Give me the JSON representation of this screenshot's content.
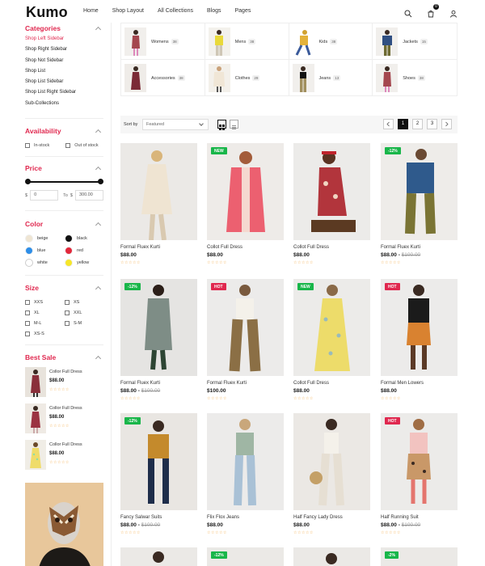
{
  "brand": "Kumo",
  "nav": [
    "Home",
    "Shop Layout",
    "All Collections",
    "Blogs",
    "Pages"
  ],
  "cart_count": "0",
  "sidebar": {
    "categories_title": "Categories",
    "categories": [
      "Shop Left Sidebar",
      "Shop Right Sidebar",
      "Shop Not Sidebar",
      "Shop List",
      "Shop List Sidebar",
      "Shop List Right Sidebar",
      "Sub-Collections"
    ],
    "availability_title": "Availability",
    "in_stock": "In-stock",
    "out_of_stock": "Out of stock",
    "price_title": "Price",
    "currency": "$",
    "price_min": "0",
    "price_to": "To",
    "price_max": "300.00",
    "color_title": "Color",
    "colors": [
      {
        "name": "beige",
        "hex": "#efe5d3"
      },
      {
        "name": "black",
        "hex": "#111111"
      },
      {
        "name": "blue",
        "hex": "#2d8ee8"
      },
      {
        "name": "red",
        "hex": "#e2283b"
      },
      {
        "name": "white",
        "hex": "#ffffff"
      },
      {
        "name": "yellow",
        "hex": "#f6e62a"
      }
    ],
    "size_title": "Size",
    "sizes": [
      "XXS",
      "XS",
      "XL",
      "XXL",
      "M-L",
      "S-M",
      "XS-S"
    ],
    "best_sale_title": "Best Sale",
    "best_sale": [
      {
        "name": "Collor Full Dress",
        "price": "$88.00"
      },
      {
        "name": "Collor Full Dress",
        "price": "$88.00"
      },
      {
        "name": "Collor Full Dress",
        "price": "$88.00"
      }
    ]
  },
  "subcollections": [
    {
      "label": "Womens",
      "count": "38"
    },
    {
      "label": "Mens",
      "count": "38"
    },
    {
      "label": "Kids",
      "count": "38"
    },
    {
      "label": "Jackets",
      "count": "15"
    },
    {
      "label": "Accessories",
      "count": "38"
    },
    {
      "label": "Clothes",
      "count": "29"
    },
    {
      "label": "Jeans",
      "count": "13"
    },
    {
      "label": "Shoes",
      "count": "38"
    }
  ],
  "toolbar": {
    "sort_label": "Sort by",
    "sort_value": "Featured",
    "pages": [
      "1",
      "2",
      "3"
    ]
  },
  "stars": "☆☆☆☆☆",
  "products": [
    {
      "name": "Formal Fluex Kurti",
      "price": "$88.00",
      "old": "",
      "badge": "",
      "badge_type": ""
    },
    {
      "name": "Collot Full Dress",
      "price": "$88.00",
      "old": "",
      "badge": "NEW",
      "badge_type": "new"
    },
    {
      "name": "Collot Full Dress",
      "price": "$88.00",
      "old": "",
      "badge": "",
      "badge_type": ""
    },
    {
      "name": "Formal Fluex Kurti",
      "price": "$88.00",
      "old": "$100.00",
      "badge": "-12%",
      "badge_type": "sale"
    },
    {
      "name": "Formal Fluex Kurti",
      "price": "$88.00",
      "old": "$100.00",
      "badge": "-12%",
      "badge_type": "sale"
    },
    {
      "name": "Formal Fluex Kurti",
      "price": "$100.00",
      "old": "",
      "badge": "HOT",
      "badge_type": "hot"
    },
    {
      "name": "Collot Full Dress",
      "price": "$88.00",
      "old": "",
      "badge": "NEW",
      "badge_type": "new"
    },
    {
      "name": "Formal Men Lowers",
      "price": "$88.00",
      "old": "",
      "badge": "HOT",
      "badge_type": "hot"
    },
    {
      "name": "Fancy Salwar Suits",
      "price": "$88.00",
      "old": "$100.00",
      "badge": "-12%",
      "badge_type": "sale"
    },
    {
      "name": "Flix Flox Jeans",
      "price": "$88.00",
      "old": "",
      "badge": "",
      "badge_type": ""
    },
    {
      "name": "Half Fancy Lady Dress",
      "price": "$88.00",
      "old": "",
      "badge": "",
      "badge_type": ""
    },
    {
      "name": "Half Running Suit",
      "price": "$88.00",
      "old": "$100.00",
      "badge": "HOT",
      "badge_type": "hot"
    }
  ],
  "partial_badges": [
    "-12%",
    "-2%"
  ]
}
